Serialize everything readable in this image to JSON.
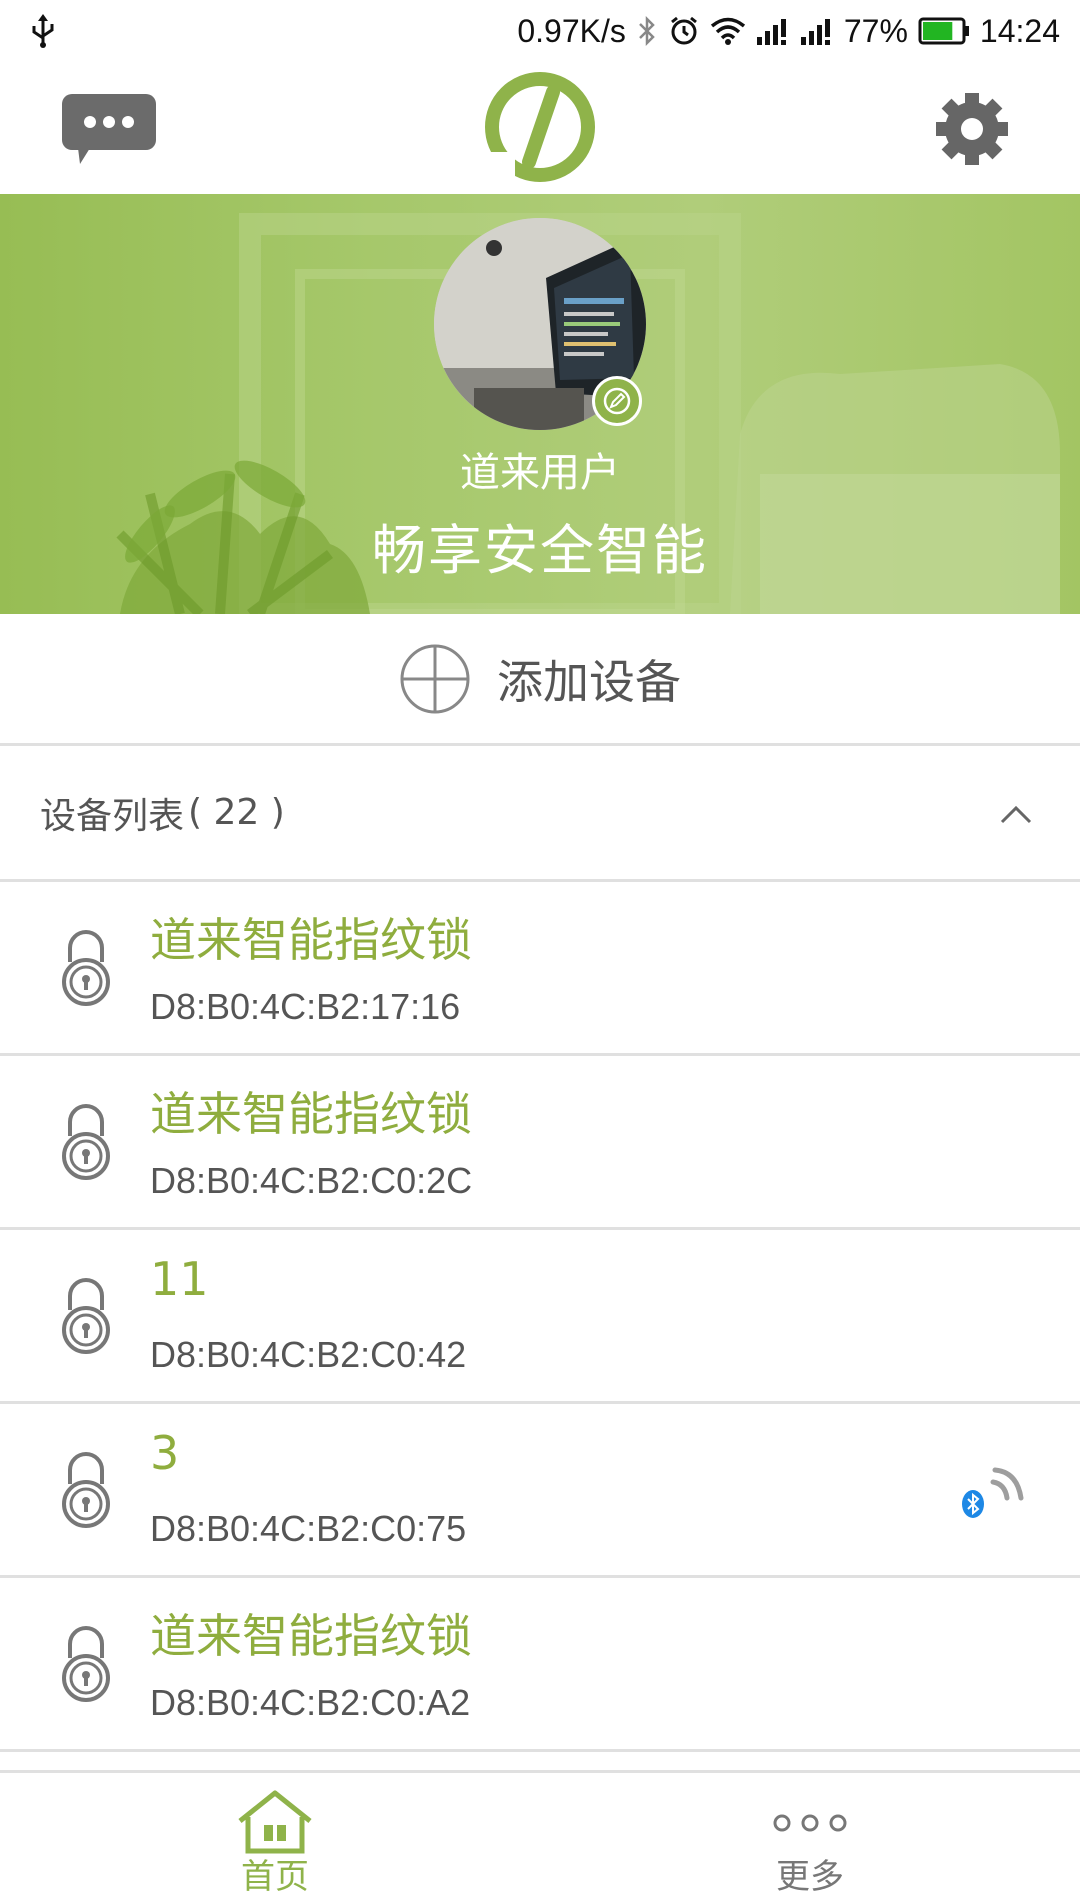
{
  "status_bar": {
    "net_speed": "0.97K/s",
    "battery_percent": "77%",
    "battery_level": 0.77,
    "time": "14:24",
    "icons": [
      "usb-icon",
      "bluetooth-icon",
      "alarm-icon",
      "wifi-icon",
      "signal-icon",
      "signal-icon",
      "battery-icon"
    ]
  },
  "header": {
    "left_icon": "chat-bubble-icon",
    "logo": "app-logo",
    "right_icon": "gear-icon"
  },
  "profile": {
    "user_name": "道来用户",
    "slogan": "畅享安全智能",
    "edit_icon": "pencil-icon"
  },
  "add_device": {
    "label": "添加设备",
    "icon": "plus-circle-icon"
  },
  "device_list": {
    "title": "设备列表",
    "count_text": "( 22 )",
    "collapse_icon": "chevron-up-icon",
    "items": [
      {
        "name": "道来智能指纹锁",
        "mac": "D8:B0:4C:B2:17:16",
        "connected": false
      },
      {
        "name": "道来智能指纹锁",
        "mac": "D8:B0:4C:B2:C0:2C",
        "connected": false
      },
      {
        "name": "11",
        "mac": "D8:B0:4C:B2:C0:42",
        "connected": false
      },
      {
        "name": "3",
        "mac": "D8:B0:4C:B2:C0:75",
        "connected": true
      },
      {
        "name": "道来智能指纹锁",
        "mac": "D8:B0:4C:B2:C0:A2",
        "connected": false
      }
    ]
  },
  "bottom_nav": {
    "home_label": "首页",
    "more_label": "更多"
  },
  "colors": {
    "brand_green": "#8fb34a",
    "device_name": "#8fad3e",
    "bluetooth_blue": "#1e88e5"
  }
}
